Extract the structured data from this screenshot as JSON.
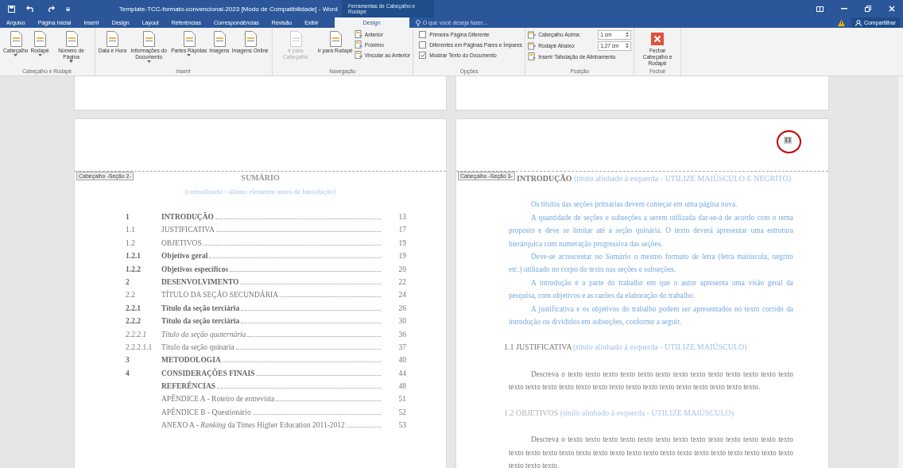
{
  "window": {
    "title": "Template-TCC-formato-convencional-2023 [Modo de Compatibilidade] - Word",
    "contextual_title": "Ferramentas de Cabeçalho e Rodapé"
  },
  "tabs": [
    {
      "label": "Arquivo",
      "selected": false
    },
    {
      "label": "Página Inicial",
      "selected": false
    },
    {
      "label": "Inserir",
      "selected": false
    },
    {
      "label": "Design",
      "selected": false
    },
    {
      "label": "Layout",
      "selected": false
    },
    {
      "label": "Referências",
      "selected": false
    },
    {
      "label": "Correspondências",
      "selected": false
    },
    {
      "label": "Revisão",
      "selected": false
    },
    {
      "label": "Exibir",
      "selected": false
    },
    {
      "label": "Design",
      "selected": true
    }
  ],
  "search": {
    "placeholder": "O que você deseja fazer..."
  },
  "share": {
    "label": "Compartilhar"
  },
  "ribbon": [
    {
      "label": "Cabeçalho e Rodapé",
      "items": [
        {
          "kind": "large",
          "label": "Cabeçalho",
          "dropdown": true,
          "disabled": false
        },
        {
          "kind": "large",
          "label": "Rodapé",
          "dropdown": true,
          "disabled": false
        },
        {
          "kind": "large",
          "label": "Número de Página",
          "dropdown": true,
          "disabled": false
        }
      ]
    },
    {
      "label": "Inserir",
      "items": [
        {
          "kind": "large",
          "label": "Data e Hora",
          "dropdown": false,
          "disabled": false
        },
        {
          "kind": "large",
          "label": "Informações do Documento",
          "dropdown": true,
          "disabled": false
        },
        {
          "kind": "large",
          "label": "Partes Rápidas",
          "dropdown": true,
          "disabled": false
        },
        {
          "kind": "large",
          "label": "Imagens",
          "dropdown": false,
          "disabled": false
        },
        {
          "kind": "large",
          "label": "Imagens Online",
          "dropdown": false,
          "disabled": false
        }
      ]
    },
    {
      "label": "Navegação",
      "items": [
        {
          "kind": "large",
          "label": "Ir para Cabeçalho",
          "dropdown": false,
          "disabled": true
        },
        {
          "kind": "large",
          "label": "Ir para Rodapé",
          "dropdown": false,
          "disabled": false
        },
        {
          "kind": "small",
          "label": "Anterior",
          "disabled": false
        },
        {
          "kind": "small",
          "label": "Próximo",
          "disabled": false
        },
        {
          "kind": "small",
          "label": "Vincular ao Anterior",
          "disabled": false
        }
      ]
    },
    {
      "label": "Opções",
      "items": [
        {
          "kind": "checkbox",
          "label": "Primeira Página Diferente",
          "checked": false,
          "disabled": false
        },
        {
          "kind": "checkbox",
          "label": "Diferentes em Páginas Pares e Ímpares",
          "checked": false,
          "disabled": false
        },
        {
          "kind": "checkbox",
          "label": "Mostrar Texto do Documento",
          "checked": true,
          "disabled": false
        }
      ]
    },
    {
      "label": "Posição",
      "items": [
        {
          "kind": "spin",
          "label": "Cabeçalho Acima:",
          "value": "1 cm",
          "disabled": false
        },
        {
          "kind": "spin",
          "label": "Rodapé Abaixo:",
          "value": "1,27 cm",
          "disabled": false
        },
        {
          "kind": "small",
          "label": "Inserir Tabulação de Alinhamento",
          "disabled": false
        }
      ]
    },
    {
      "label": "Fechar",
      "items": [
        {
          "kind": "close",
          "label": "Fechar Cabeçalho e Rodapé",
          "dropdown": false,
          "disabled": false
        }
      ]
    }
  ],
  "left_page": {
    "header_tag": "Cabeçalho -Seção 2-",
    "heading": "SUMÁRIO",
    "note": "(centralizado - último elemento antes da Introdução)",
    "toc": [
      {
        "number": "1",
        "title": "INTRODUÇÃO",
        "page": "13",
        "kind": "bold"
      },
      {
        "number": "1.1",
        "title": "JUSTIFICATIVA",
        "page": "17",
        "kind": "plain"
      },
      {
        "number": "1.2",
        "title": "OBJETIVOS",
        "page": "19",
        "kind": "plain"
      },
      {
        "number": "1.2.1",
        "title": "Objetivo geral",
        "page": "19",
        "kind": "bold"
      },
      {
        "number": "1.2.2",
        "title": "Objetivos específicos",
        "page": "20",
        "kind": "bold"
      },
      {
        "number": "2",
        "title": "DESENVOLVIMENTO",
        "page": "22",
        "kind": "bold"
      },
      {
        "number": "2.2",
        "title": "TÍTULO DA SEÇÃO SECUNDÁRIA",
        "page": "24",
        "kind": "plain"
      },
      {
        "number": "2.2.1",
        "title": "Título da seção terciária",
        "page": "26",
        "kind": "bold"
      },
      {
        "number": "2.2.2",
        "title": "Título da seção terciária",
        "page": "30",
        "kind": "bold"
      },
      {
        "number": "2.2.2.1",
        "title": "Título da seção quaternária",
        "page": "36",
        "kind": "italic"
      },
      {
        "number": "2.2.2.1.1",
        "title": "Título da seção quinaria",
        "page": "37",
        "kind": "plain"
      },
      {
        "number": "3",
        "title": "METODOLOGIA",
        "page": "40",
        "kind": "bold"
      },
      {
        "number": "4",
        "title": "CONSIDERAÇÕES FINAIS",
        "page": "44",
        "kind": "bold"
      },
      {
        "title": "REFERÊNCIAS",
        "page": "48",
        "kind": "bold"
      },
      {
        "title": "APÊNDICE A - Roteiro de entrevista",
        "page": "51",
        "kind": "plain"
      },
      {
        "title": "APÊNDICE B - Questionário",
        "page": "52",
        "kind": "plain"
      },
      {
        "title": "ANEXO A - *Ranking* da Times Higher Education 2011-2012",
        "page": "53",
        "kind": "plain"
      }
    ]
  },
  "right_page": {
    "header_tag": "Cabeçalho -Seção 3-",
    "page_number": "13",
    "circled": true,
    "blocks": [
      {
        "kind": "chapter",
        "text": "INTRODUÇÃO",
        "note": "(título alinhado à esquerda - UTILIZE MAIÚSCULO E NEGRITO)"
      },
      {
        "kind": "instruction",
        "text": "Os títulos das seções primárias devem começar em uma página nova."
      },
      {
        "kind": "instruction",
        "text": "A quantidade de seções e subseções a serem utilizada dar-se-á de acordo com o tema proposto e deve se limitar até a seção quinária. O texto deverá apresentar uma estrutura hierárquica com numeração progressiva das seções."
      },
      {
        "kind": "instruction",
        "text": "Deve-se acrescentar no Sumário o mesmo formato de letra (letra maiúscula, negrito etc.) utilizado no corpo do texto nas seções e subseções."
      },
      {
        "kind": "instruction",
        "text": "A introdução é a parte do trabalho em que o autor apresenta uma visão geral da pesquisa, com objetivos e as razões da elaboração do trabalho."
      },
      {
        "kind": "instruction",
        "text": "A justificativa e os objetivos do trabalho podem ser apresentados no texto corrido da introdução ou divididos em subseções, conforme a seguir."
      },
      {
        "kind": "section",
        "text": "1.1 JUSTIFICATIVA",
        "note": "(título alinhado à esquerda - UTILIZE MAIÚSCULO)"
      },
      {
        "kind": "paragraph",
        "text": "Descreva o texto texto texto texto texto texto texto texto texto texto texto texto texto texto texto texto texto texto texto texto texto texto texto texto texto texto texto texto."
      },
      {
        "kind": "ghost",
        "text": "1.2 OBJETIVOS",
        "note": "(título alinhado à esquerda - UTILIZE MAIÚSCULO)"
      },
      {
        "kind": "paragraph",
        "text": "Descreva o texto texto texto texto texto texto texto texto texto texto texto texto texto texto texto texto texto texto texto texto texto texto texto texto texto texto texto texto texto texto texto texto texto."
      }
    ]
  }
}
